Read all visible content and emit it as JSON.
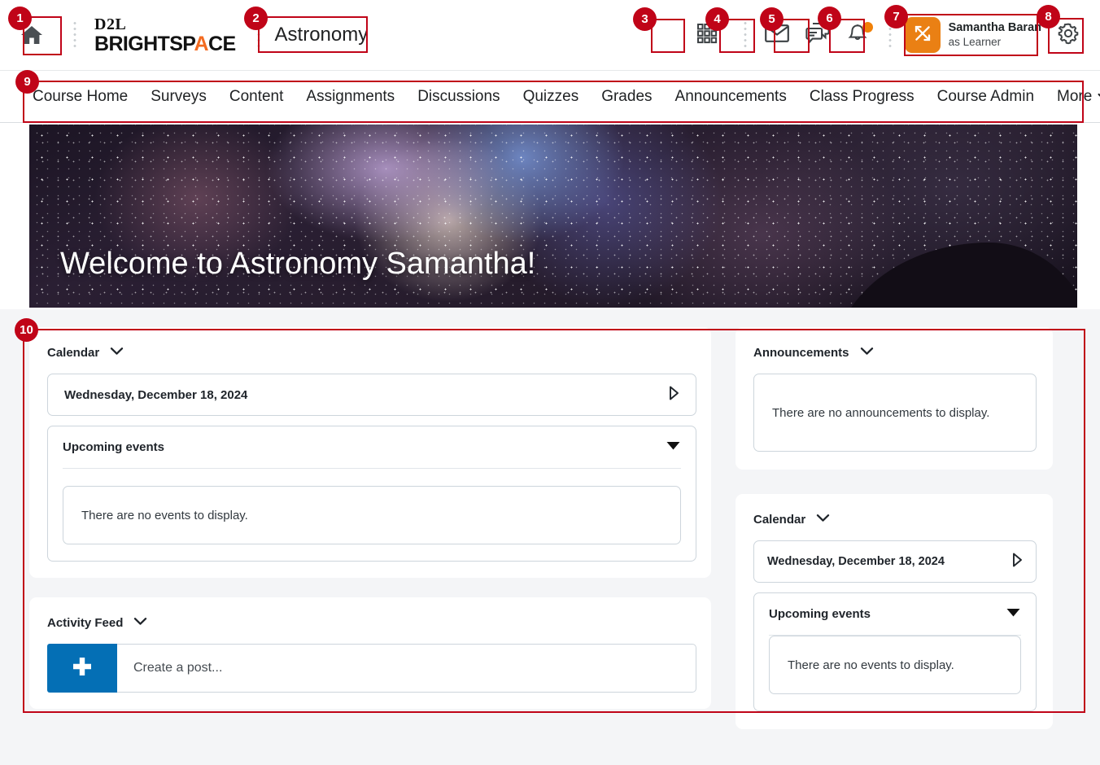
{
  "topbar": {
    "home_icon": "home-icon",
    "logo": {
      "d2l": "D2L",
      "brightspace_a": "BRIGHTSP",
      "brightspace_accent": "A",
      "brightspace_b": "CE"
    },
    "course_title": "Astronomy",
    "icons": [
      {
        "name": "waffle-menu-icon",
        "label": "Course Selector"
      },
      {
        "name": "envelope-icon",
        "label": "Message Alerts"
      },
      {
        "name": "chat-bubble-icon",
        "label": "Subscription Alerts"
      },
      {
        "name": "bell-icon",
        "label": "Update Alerts",
        "has_badge": true,
        "badge_color": "#f08008"
      }
    ],
    "user": {
      "avatar_icon": "switch-arrows-icon",
      "avatar_color": "#ea8014",
      "name": "Samantha Baran",
      "role": "as Learner"
    },
    "settings_icon": "gear-icon"
  },
  "coursenav": {
    "items": [
      "Course Home",
      "Surveys",
      "Content",
      "Assignments",
      "Discussions",
      "Quizzes",
      "Grades",
      "Announcements",
      "Class Progress",
      "Course Admin"
    ],
    "more_label": "More",
    "more_icon": "chevron-down-icon"
  },
  "banner": {
    "title": "Welcome to Astronomy Samantha!",
    "image_alt": "milky-way-starfield-banner"
  },
  "widgets": {
    "calendar_left": {
      "title": "Calendar",
      "collapse_icon": "chevron-down-icon",
      "date": "Wednesday, December 18, 2024",
      "next_icon": "triangle-right-icon",
      "events_label": "Upcoming events",
      "events_collapse_icon": "triangle-down-icon",
      "empty_text": "There are no events to display."
    },
    "activity_feed": {
      "title": "Activity Feed",
      "collapse_icon": "chevron-down-icon",
      "create_post_icon": "plus-icon",
      "create_post_placeholder": "Create a post..."
    },
    "announcements": {
      "title": "Announcements",
      "collapse_icon": "chevron-down-icon",
      "empty_text": "There are no announcements to display."
    },
    "calendar_right": {
      "title": "Calendar",
      "collapse_icon": "chevron-down-icon",
      "date": "Wednesday, December 18, 2024",
      "next_icon": "triangle-right-icon",
      "events_label": "Upcoming events",
      "events_collapse_icon": "triangle-down-icon",
      "empty_text": "There are no events to display."
    }
  },
  "annotations": {
    "color": "#c00418",
    "callouts": [
      {
        "n": "1",
        "target": "home-button"
      },
      {
        "n": "2",
        "target": "course-title"
      },
      {
        "n": "3",
        "target": "course-selector-button"
      },
      {
        "n": "4",
        "target": "message-alerts-button"
      },
      {
        "n": "5",
        "target": "subscription-alerts-button"
      },
      {
        "n": "6",
        "target": "update-alerts-button"
      },
      {
        "n": "7",
        "target": "user-profile-button"
      },
      {
        "n": "8",
        "target": "settings-button"
      },
      {
        "n": "9",
        "target": "course-navbar"
      },
      {
        "n": "10",
        "target": "homepage-widgets-area"
      }
    ]
  }
}
